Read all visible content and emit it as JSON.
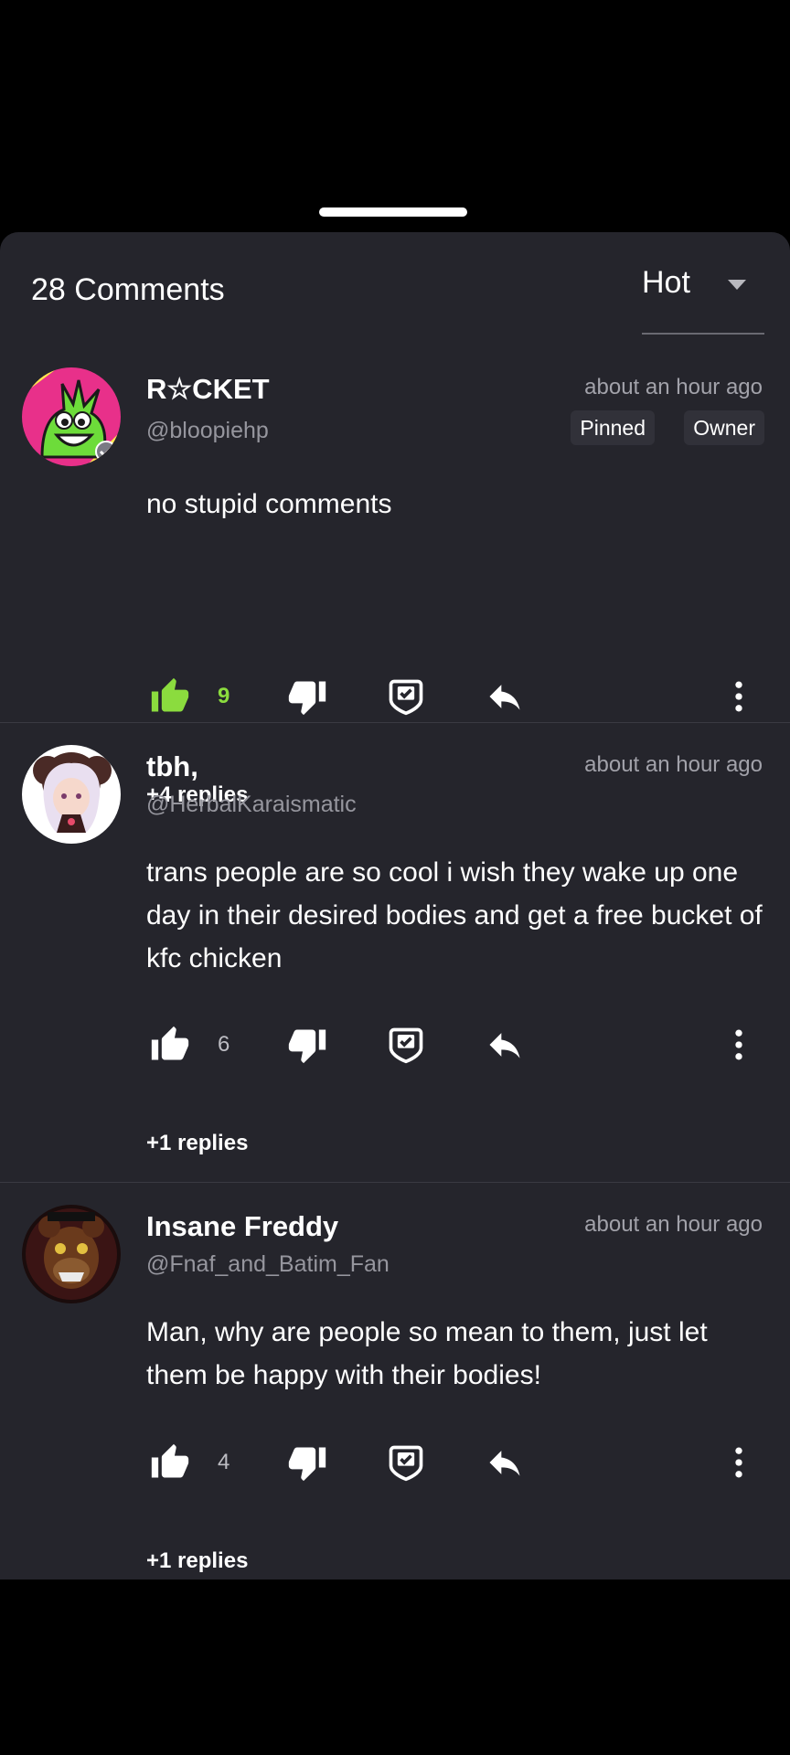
{
  "header": {
    "comment_count": "28 Comments",
    "sort_label": "Hot"
  },
  "colors": {
    "sheet_bg": "#25252c",
    "like_active": "#8bdc3e",
    "muted_text": "#96969e"
  },
  "comments": [
    {
      "display_name": "R☆CKET",
      "handle": "@bloopiehp",
      "time": "about an hour ago",
      "badges": [
        "Pinned",
        "Owner"
      ],
      "text": "no stupid comments",
      "likes": "9",
      "liked": true,
      "replies": "+4 replies"
    },
    {
      "display_name": "tbh,",
      "handle": "@HerbalKaraismatic",
      "time": "about an hour ago",
      "badges": [],
      "text": "trans people are so cool i wish they wake up one day in their desired bodies and get a free bucket of kfc chicken",
      "likes": "6",
      "liked": false,
      "replies": "+1 replies"
    },
    {
      "display_name": "Insane Freddy",
      "handle": "@Fnaf_and_Batim_Fan",
      "time": "about an hour ago",
      "badges": [],
      "text": "Man, why are people so mean to them, just let them be happy with their bodies!",
      "likes": "4",
      "liked": false,
      "replies": "+1 replies"
    }
  ],
  "icons": {
    "like": "thumbs-up-icon",
    "dislike": "thumbs-down-icon",
    "award": "award-icon",
    "reply": "reply-icon",
    "more": "more-vertical-icon"
  }
}
